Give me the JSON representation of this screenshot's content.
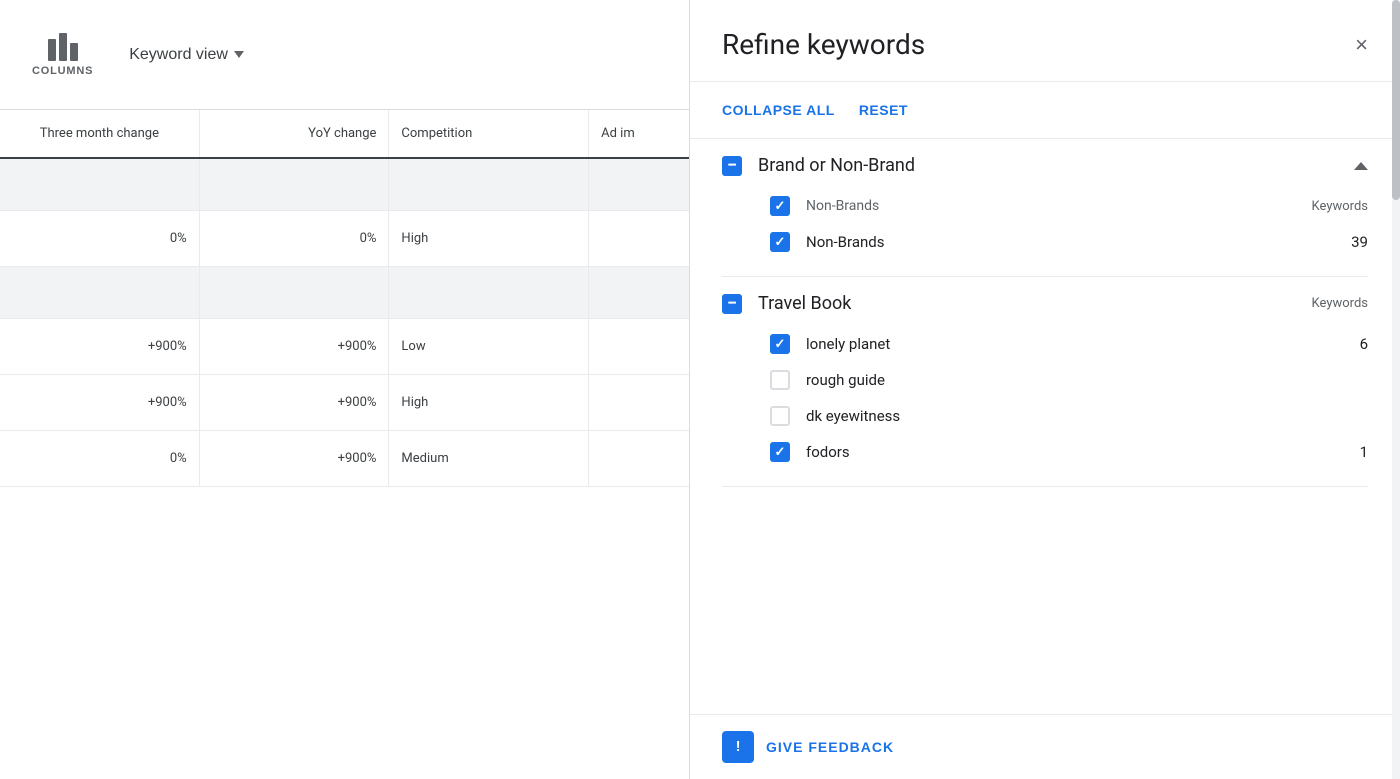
{
  "toolbar": {
    "columns_label": "COLUMNS",
    "keyword_view_label": "Keyword view"
  },
  "table": {
    "headers": [
      {
        "id": "three_month",
        "label": "Three month change"
      },
      {
        "id": "yoy",
        "label": "YoY change"
      },
      {
        "id": "competition",
        "label": "Competition"
      },
      {
        "id": "adim",
        "label": "Ad im"
      }
    ],
    "rows": [
      {
        "type": "group",
        "three_month": "",
        "yoy": "",
        "competition": "",
        "adim": ""
      },
      {
        "type": "data",
        "three_month": "0%",
        "yoy": "0%",
        "competition": "High",
        "adim": ""
      },
      {
        "type": "group",
        "three_month": "",
        "yoy": "",
        "competition": "",
        "adim": ""
      },
      {
        "type": "data",
        "three_month": "+900%",
        "yoy": "+900%",
        "competition": "Low",
        "adim": ""
      },
      {
        "type": "data",
        "three_month": "+900%",
        "yoy": "+900%",
        "competition": "High",
        "adim": ""
      },
      {
        "type": "data",
        "three_month": "0%",
        "yoy": "+900%",
        "competition": "Medium",
        "adim": ""
      }
    ]
  },
  "refine": {
    "title": "Refine keywords",
    "close_label": "×",
    "collapse_all_label": "COLLAPSE ALL",
    "reset_label": "RESET",
    "sections": [
      {
        "id": "brand_or_non_brand",
        "title": "Brand or Non-Brand",
        "state": "minus",
        "expanded": true,
        "items": [
          {
            "id": "non_brands_parent",
            "label": "Non-Brands",
            "keywords_header": "Keywords",
            "state": "checked",
            "count": null,
            "is_parent": true,
            "children": [
              {
                "id": "non_brands_child",
                "label": "Non-Brands",
                "state": "checked",
                "count": "39"
              }
            ]
          }
        ]
      },
      {
        "id": "travel_book",
        "title": "Travel Book",
        "state": "minus",
        "expanded": true,
        "items": [
          {
            "id": "lonely_planet",
            "label": "lonely planet",
            "state": "checked",
            "count": "6"
          },
          {
            "id": "rough_guide",
            "label": "rough guide",
            "state": "unchecked",
            "count": null
          },
          {
            "id": "dk_eyewitness",
            "label": "dk eyewitness",
            "state": "unchecked",
            "count": null
          },
          {
            "id": "fodors",
            "label": "fodors",
            "state": "checked",
            "count": "1"
          }
        ]
      }
    ],
    "feedback": {
      "icon_label": "!",
      "button_label": "GIVE FEEDBACK"
    }
  }
}
